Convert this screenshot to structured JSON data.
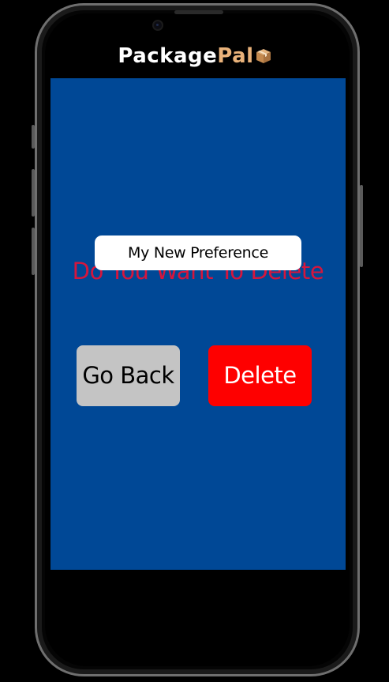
{
  "app": {
    "logo_part1": "Package",
    "logo_part2": "Pal",
    "logo_icon": "package-box-icon"
  },
  "dialog": {
    "prompt": "Do You Want To Delete",
    "preference_name": "My New Preference",
    "go_back_label": "Go Back",
    "delete_label": "Delete"
  },
  "colors": {
    "screen_background": "#004896",
    "prompt_text": "#d5163d",
    "go_back_button": "#c4c4c4",
    "delete_button": "#fe0000",
    "logo_accent": "#e9b27a"
  }
}
